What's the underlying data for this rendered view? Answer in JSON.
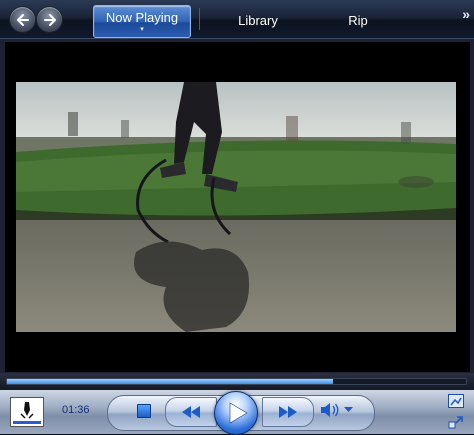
{
  "toolbar": {
    "tabs": [
      {
        "label": "Now Playing",
        "active": true
      },
      {
        "label": "Library",
        "active": false
      },
      {
        "label": "Rip",
        "active": false
      }
    ],
    "active_tab_arrow": "▾",
    "more_icon": "»"
  },
  "icons": {
    "back": "back-arrow-icon",
    "forward": "forward-arrow-icon",
    "stop": "stop-icon",
    "previous": "previous-icon",
    "play": "play-icon",
    "next": "next-icon",
    "volume": "speaker-icon",
    "volume_dropdown": "chevron-down-icon",
    "switch_to_library": "switch-view-icon",
    "resize": "resize-icon"
  },
  "playback": {
    "elapsed": "01:36",
    "progress_fraction": 0.71
  },
  "colors": {
    "accent": "#2f62b3",
    "seek_fill": "#3f8ee6",
    "time_text": "#12307a"
  }
}
